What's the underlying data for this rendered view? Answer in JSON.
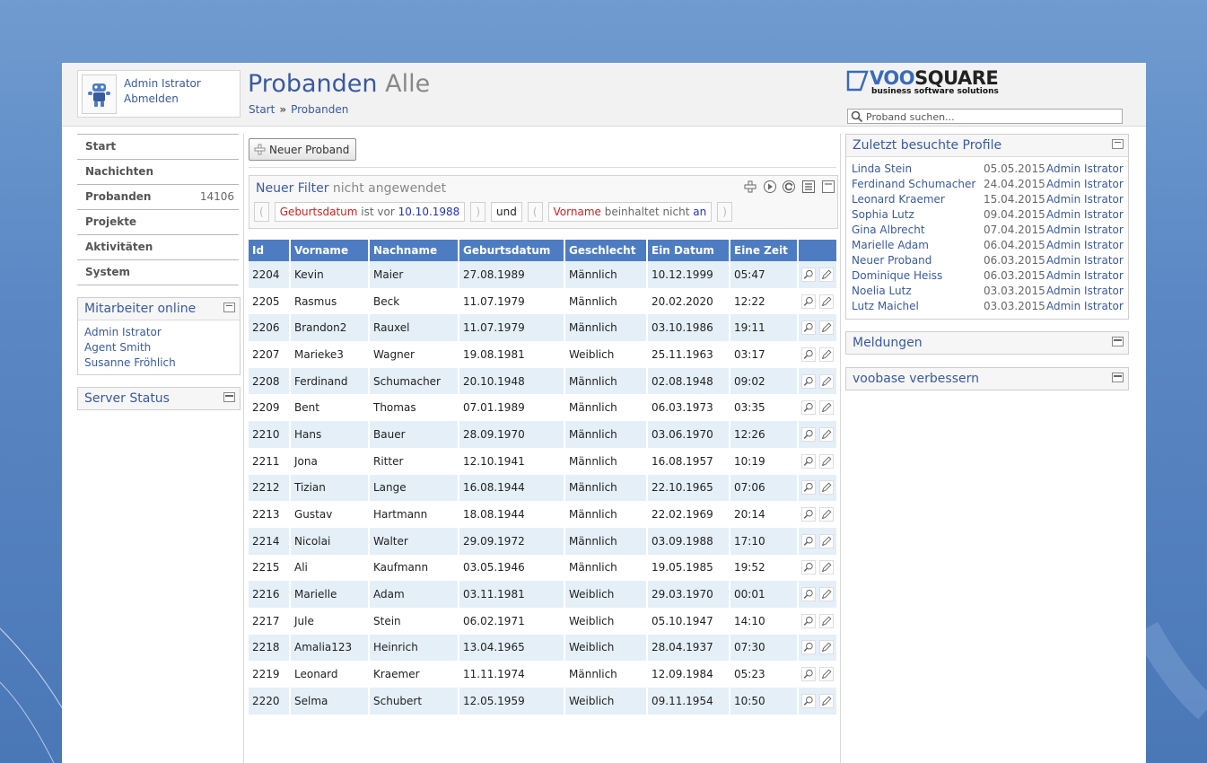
{
  "user": {
    "name": "Admin Istrator",
    "logout": "Abmelden"
  },
  "page": {
    "title": "Probanden",
    "subtitle": "Alle"
  },
  "breadcrumb": {
    "start": "Start",
    "separator": "»",
    "current": "Probanden"
  },
  "logo": {
    "text_a": "VOO",
    "text_b": "SQUARE",
    "tagline": "business software solutions"
  },
  "search": {
    "placeholder": "Proband suchen..."
  },
  "nav": {
    "items": [
      {
        "label": "Start",
        "count": ""
      },
      {
        "label": "Nachichten",
        "count": ""
      },
      {
        "label": "Probanden",
        "count": "14106"
      },
      {
        "label": "Projekte",
        "count": ""
      },
      {
        "label": "Aktivitäten",
        "count": ""
      },
      {
        "label": "System",
        "count": ""
      }
    ]
  },
  "staff_panel": {
    "title": "Mitarbeiter online",
    "items": [
      "Admin Istrator",
      "Agent Smith",
      "Susanne Fröhlich"
    ]
  },
  "server_panel": {
    "title": "Server Status"
  },
  "toolbar": {
    "new_label": "Neuer Proband"
  },
  "filter": {
    "title": "Neuer Filter",
    "state": "nicht angewendet",
    "open_paren": "(",
    "close_paren": ")",
    "cond1": {
      "field": "Geburtsdatum",
      "op": "ist vor",
      "value": "10.10.1988"
    },
    "conjunction": "und",
    "cond2": {
      "field": "Vorname",
      "op": "beinhaltet nicht",
      "value": "an"
    }
  },
  "table": {
    "headers": [
      "Id",
      "Vorname",
      "Nachname",
      "Geburtsdatum",
      "Geschlecht",
      "Ein Datum",
      "Eine Zeit"
    ],
    "rows": [
      [
        "2204",
        "Kevin",
        "Maier",
        "27.08.1989",
        "Männlich",
        "10.12.1999",
        "05:47"
      ],
      [
        "2205",
        "Rasmus",
        "Beck",
        "11.07.1979",
        "Männlich",
        "20.02.2020",
        "12:22"
      ],
      [
        "2206",
        "Brandon2",
        "Rauxel",
        "11.07.1979",
        "Männlich",
        "03.10.1986",
        "19:11"
      ],
      [
        "2207",
        "Marieke3",
        "Wagner",
        "19.08.1981",
        "Weiblich",
        "25.11.1963",
        "03:17"
      ],
      [
        "2208",
        "Ferdinand",
        "Schumacher",
        "20.10.1948",
        "Männlich",
        "02.08.1948",
        "09:02"
      ],
      [
        "2209",
        "Bent",
        "Thomas",
        "07.01.1989",
        "Männlich",
        "06.03.1973",
        "03:35"
      ],
      [
        "2210",
        "Hans",
        "Bauer",
        "28.09.1970",
        "Männlich",
        "03.06.1970",
        "12:26"
      ],
      [
        "2211",
        "Jona",
        "Ritter",
        "12.10.1941",
        "Männlich",
        "16.08.1957",
        "10:19"
      ],
      [
        "2212",
        "Tizian",
        "Lange",
        "16.08.1944",
        "Männlich",
        "22.10.1965",
        "07:06"
      ],
      [
        "2213",
        "Gustav",
        "Hartmann",
        "18.08.1944",
        "Männlich",
        "22.02.1969",
        "20:14"
      ],
      [
        "2214",
        "Nicolai",
        "Walter",
        "29.09.1972",
        "Männlich",
        "03.09.1988",
        "17:10"
      ],
      [
        "2215",
        "Ali",
        "Kaufmann",
        "03.05.1946",
        "Männlich",
        "19.05.1985",
        "19:52"
      ],
      [
        "2216",
        "Marielle",
        "Adam",
        "03.11.1981",
        "Weiblich",
        "29.03.1970",
        "00:01"
      ],
      [
        "2217",
        "Jule",
        "Stein",
        "06.02.1971",
        "Weiblich",
        "05.10.1947",
        "14:10"
      ],
      [
        "2218",
        "Amalia123",
        "Heinrich",
        "13.04.1965",
        "Weiblich",
        "28.04.1937",
        "07:30"
      ],
      [
        "2219",
        "Leonard",
        "Kraemer",
        "11.11.1974",
        "Männlich",
        "12.09.1984",
        "05:23"
      ],
      [
        "2220",
        "Selma",
        "Schubert",
        "12.05.1959",
        "Weiblich",
        "09.11.1954",
        "10:50"
      ]
    ]
  },
  "recent_panel": {
    "title": "Zuletzt besuchte Profile",
    "items": [
      {
        "name": "Linda Stein",
        "date": "05.05.2015",
        "user": "Admin Istrator"
      },
      {
        "name": "Ferdinand Schumacher",
        "date": "24.04.2015",
        "user": "Admin Istrator"
      },
      {
        "name": "Leonard Kraemer",
        "date": "15.04.2015",
        "user": "Admin Istrator"
      },
      {
        "name": "Sophia Lutz",
        "date": "09.04.2015",
        "user": "Admin Istrator"
      },
      {
        "name": "Gina Albrecht",
        "date": "07.04.2015",
        "user": "Admin Istrator"
      },
      {
        "name": "Marielle Adam",
        "date": "06.04.2015",
        "user": "Admin Istrator"
      },
      {
        "name": "Neuer Proband",
        "date": "06.03.2015",
        "user": "Admin Istrator"
      },
      {
        "name": "Dominique Heiss",
        "date": "06.03.2015",
        "user": "Admin Istrator"
      },
      {
        "name": "Noelia Lutz",
        "date": "03.03.2015",
        "user": "Admin Istrator"
      },
      {
        "name": "Lutz Maichel",
        "date": "03.03.2015",
        "user": "Admin Istrator"
      }
    ]
  },
  "messages_panel": {
    "title": "Meldungen"
  },
  "improve_panel": {
    "title": "voobase verbessern"
  },
  "colors": {
    "accent": "#3a5aa0",
    "table_header": "#4d7cc2",
    "row_alt": "#e5eff8",
    "filter_field": "#cc2222",
    "filter_value": "#2233bb"
  },
  "icons": {
    "avatar": "robot-avatar-icon",
    "search": "magnifier-icon",
    "add": "plus-icon",
    "view": "magnifier-icon",
    "edit": "pencil-icon",
    "panel_min": "minimize-icon",
    "panel_max": "maximize-icon"
  }
}
